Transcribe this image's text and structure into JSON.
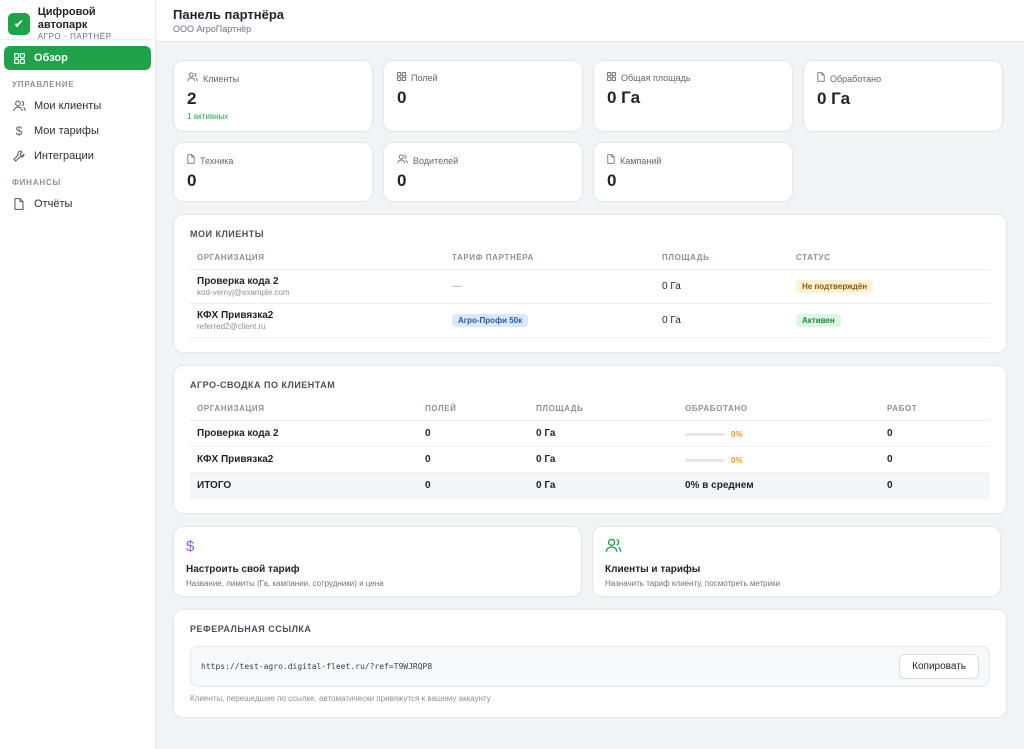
{
  "brand": {
    "name": "Цифровой автопарк",
    "subtitle": "АГРО · ПАРТНЁР"
  },
  "sidebar": {
    "overview": "Обзор",
    "section_management": "УПРАВЛЕНИЕ",
    "my_clients": "Мои клиенты",
    "my_tariffs": "Мои тарифы",
    "integrations": "Интеграции",
    "section_finance": "ФИНАНСЫ",
    "reports": "Отчёты"
  },
  "header": {
    "title": "Панель партнёра",
    "org": "ООО АгроПартнёр"
  },
  "stats": {
    "clients": {
      "label": "Клиенты",
      "value": "2",
      "hint": "1 активных"
    },
    "fields": {
      "label": "Полей",
      "value": "0"
    },
    "area": {
      "label": "Общая площадь",
      "value": "0 Га"
    },
    "processed": {
      "label": "Обработано",
      "value": "0 Га"
    },
    "machinery": {
      "label": "Техника",
      "value": "0"
    },
    "drivers": {
      "label": "Водителей",
      "value": "0"
    },
    "campaigns": {
      "label": "Кампаний",
      "value": "0"
    }
  },
  "clients_table": {
    "title": "МОИ КЛИЕНТЫ",
    "headers": {
      "org": "ОРГАНИЗАЦИЯ",
      "tariff": "ТАРИФ ПАРТНЁРА",
      "area": "ПЛОЩАДЬ",
      "status": "СТАТУС"
    },
    "rows": [
      {
        "name": "Проверка кода 2",
        "email": "kod-vernyj@example.com",
        "tariff": "—",
        "area": "0 Га",
        "status": "Не подтверждён"
      },
      {
        "name": "КФХ Привязка2",
        "email": "referred2@client.ru",
        "tariff": "Агро-Профи 50к",
        "area": "0 Га",
        "status": "Активен"
      }
    ]
  },
  "agro_summary": {
    "title": "АГРО-СВОДКА ПО КЛИЕНТАМ",
    "headers": {
      "org": "ОРГАНИЗАЦИЯ",
      "fields": "ПОЛЕЙ",
      "area": "ПЛОЩАДЬ",
      "processed": "ОБРАБОТАНО",
      "works": "РАБОТ"
    },
    "rows": [
      {
        "name": "Проверка кода 2",
        "fields": "0",
        "area": "0 Га",
        "processed_pct": "0%",
        "works": "0"
      },
      {
        "name": "КФХ Привязка2",
        "fields": "0",
        "area": "0 Га",
        "processed_pct": "0%",
        "works": "0"
      }
    ],
    "total": {
      "name": "ИТОГО",
      "fields": "0",
      "area": "0 Га",
      "processed": "0% в среднем",
      "works": "0"
    }
  },
  "actions": {
    "tariff": {
      "title": "Настроить свой тариф",
      "desc": "Название, лимиты (Га, кампании, сотрудники) и цена"
    },
    "clients": {
      "title": "Клиенты и тарифы",
      "desc": "Назначить тариф клиенту, посмотреть метрики"
    }
  },
  "referral": {
    "title": "РЕФЕРАЛЬНАЯ ССЫЛКА",
    "url": "https://test-agro.digital-fleet.ru/?ref=T9WJRQP8",
    "copy_label": "Копировать",
    "note": "Клиенты, перешедшие по ссылке, автоматически привяжутся к вашему аккаунту"
  },
  "colors": {
    "accent": "#1fa34a",
    "tariff_icon": "#8b5cf6",
    "clients_icon": "#1fa34a",
    "progress": "#e69a1a"
  }
}
